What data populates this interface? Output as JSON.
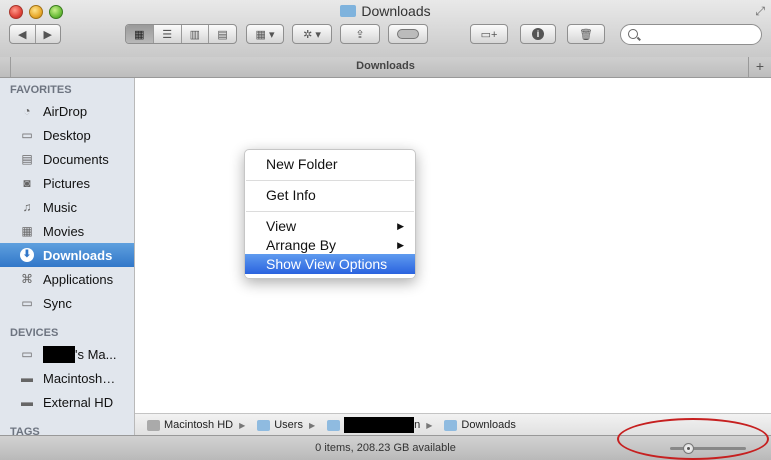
{
  "window": {
    "title": "Downloads"
  },
  "toolbar": {
    "back_icon": "back-arrow-icon",
    "forward_icon": "forward-arrow-icon",
    "views": [
      "icon-view-icon",
      "list-view-icon",
      "column-view-icon",
      "cover-flow-icon"
    ],
    "arrange_icon": "arrange-grid-icon",
    "action_icon": "gear-icon",
    "share_icon": "share-icon",
    "tags_icon": "tag-icon",
    "new_folder_icon": "new-folder-icon",
    "info_icon": "info-icon",
    "delete_icon": "trash-icon",
    "search_placeholder": ""
  },
  "tabbar": {
    "title": "Downloads"
  },
  "sidebar": {
    "favorites_header": "FAVORITES",
    "favorites": [
      {
        "label": "AirDrop",
        "icon": "airdrop-icon"
      },
      {
        "label": "Desktop",
        "icon": "desktop-icon"
      },
      {
        "label": "Documents",
        "icon": "documents-icon"
      },
      {
        "label": "Pictures",
        "icon": "camera-icon"
      },
      {
        "label": "Music",
        "icon": "music-note-icon"
      },
      {
        "label": "Movies",
        "icon": "film-icon"
      },
      {
        "label": "Downloads",
        "icon": "download-icon",
        "selected": true
      },
      {
        "label": "Applications",
        "icon": "applications-icon"
      },
      {
        "label": "Sync",
        "icon": "folder-icon"
      }
    ],
    "devices_header": "DEVICES",
    "devices": [
      {
        "label": "'s Ma...",
        "icon": "laptop-icon"
      },
      {
        "label": "Macintosh…",
        "icon": "hard-drive-icon"
      },
      {
        "label": "External HD",
        "icon": "hard-drive-icon"
      }
    ],
    "tags_header": "TAGS"
  },
  "context_menu": {
    "items": [
      {
        "label": "New Folder"
      },
      {
        "label": "Get Info"
      },
      {
        "label": "View",
        "submenu": true
      },
      {
        "label": "Arrange By",
        "submenu": true
      },
      {
        "label": "Show View Options",
        "highlighted": true
      }
    ]
  },
  "pathbar": {
    "items": [
      {
        "label": "Macintosh HD",
        "icon": "hard-drive-icon"
      },
      {
        "label": "Users",
        "icon": "folder-icon"
      },
      {
        "label": "n",
        "icon": "home-folder-icon"
      },
      {
        "label": "Downloads",
        "icon": "folder-icon"
      }
    ]
  },
  "status": {
    "text": "0 items, 208.23 GB available",
    "icon_size_fraction": 0.2
  }
}
